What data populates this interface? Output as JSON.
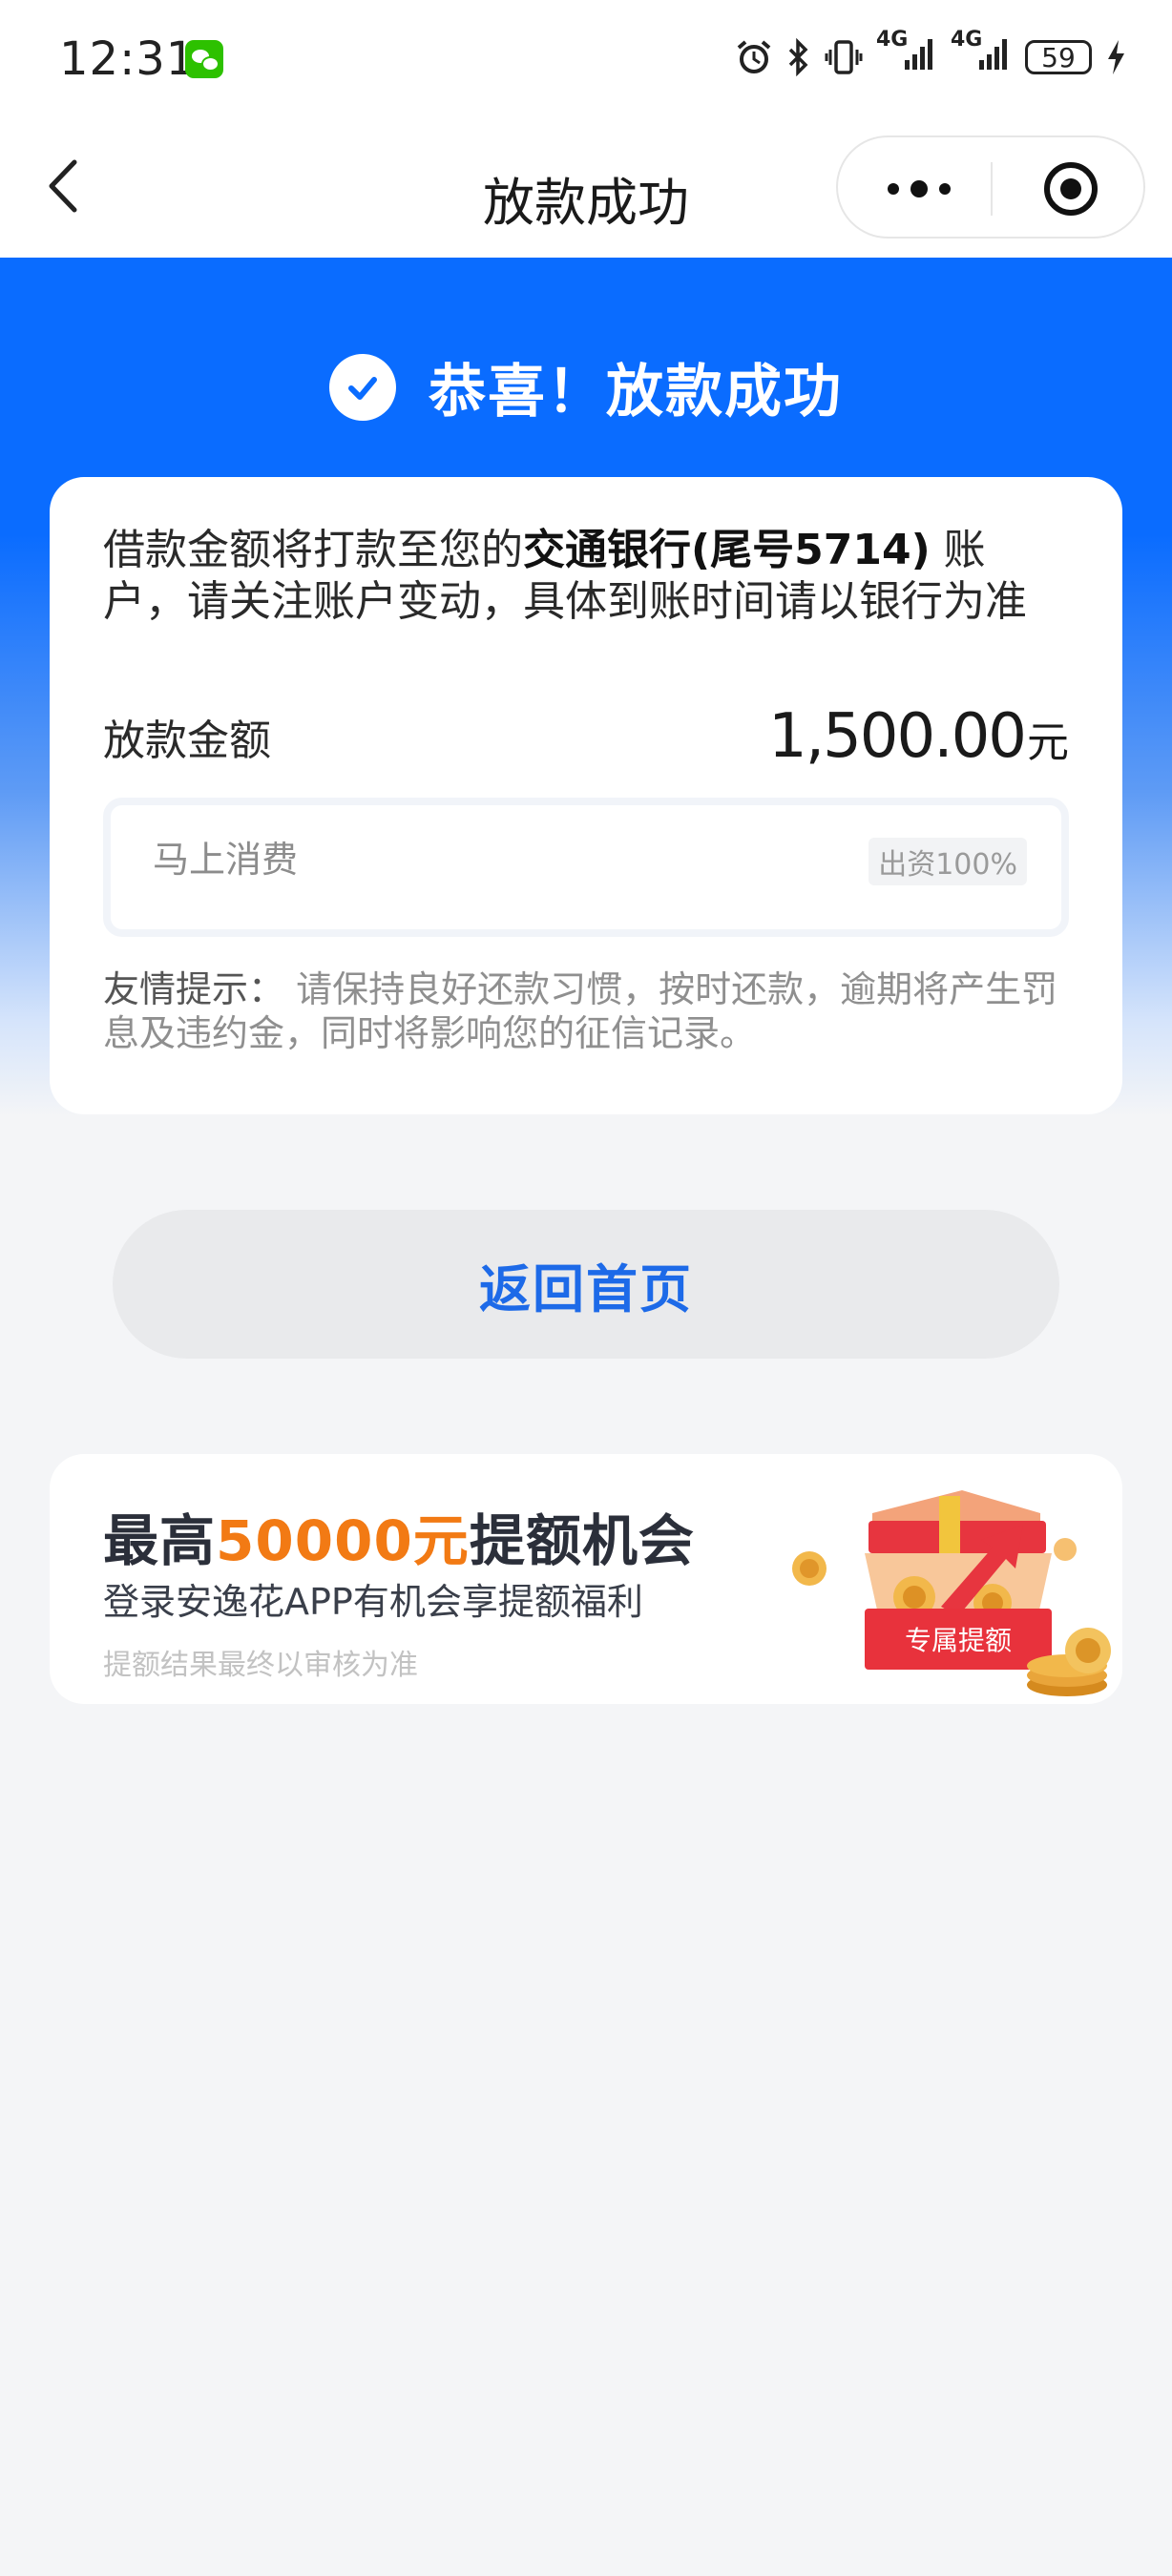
{
  "status_bar": {
    "time": "12:31",
    "network1": "4G",
    "network2": "4G",
    "battery": "59"
  },
  "nav": {
    "title": "放款成功"
  },
  "hero": {
    "title": "恭喜！放款成功"
  },
  "card": {
    "notice_prefix": "借款金额将打款至您的",
    "notice_bank": "交通银行(尾号5714)",
    "notice_suffix": " 账户，请关注账户变动，具体到账时间请以银行为准",
    "amount_label": "放款金额",
    "amount_value": "1,500.00",
    "amount_unit": "元",
    "lender_name": "马上消费",
    "lender_tag": "出资100%",
    "tip_label": "友情提示：",
    "tip_text": " 请保持良好还款习惯，按时还款，逾期将产生罚息及违约金，同时将影响您的征信记录。"
  },
  "actions": {
    "home_button": "返回首页"
  },
  "promo": {
    "title_prefix": "最高",
    "title_highlight": "50000元",
    "title_suffix": "提额机会",
    "subtitle": "登录安逸花APP有机会享提额福利",
    "note": "提额结果最终以审核为准",
    "badge": "专属提额"
  },
  "colors": {
    "primary_blue": "#0a6cff",
    "button_text": "#1d6ae8",
    "highlight_orange": "#f27a14",
    "badge_red": "#e8323c"
  },
  "icons": [
    "wechat-icon",
    "alarm-icon",
    "bluetooth-icon",
    "vibrate-icon",
    "signal-icon",
    "battery-icon",
    "charging-icon",
    "back-icon",
    "more-icon",
    "close-circle-icon",
    "check-icon",
    "gift-box-icon"
  ]
}
